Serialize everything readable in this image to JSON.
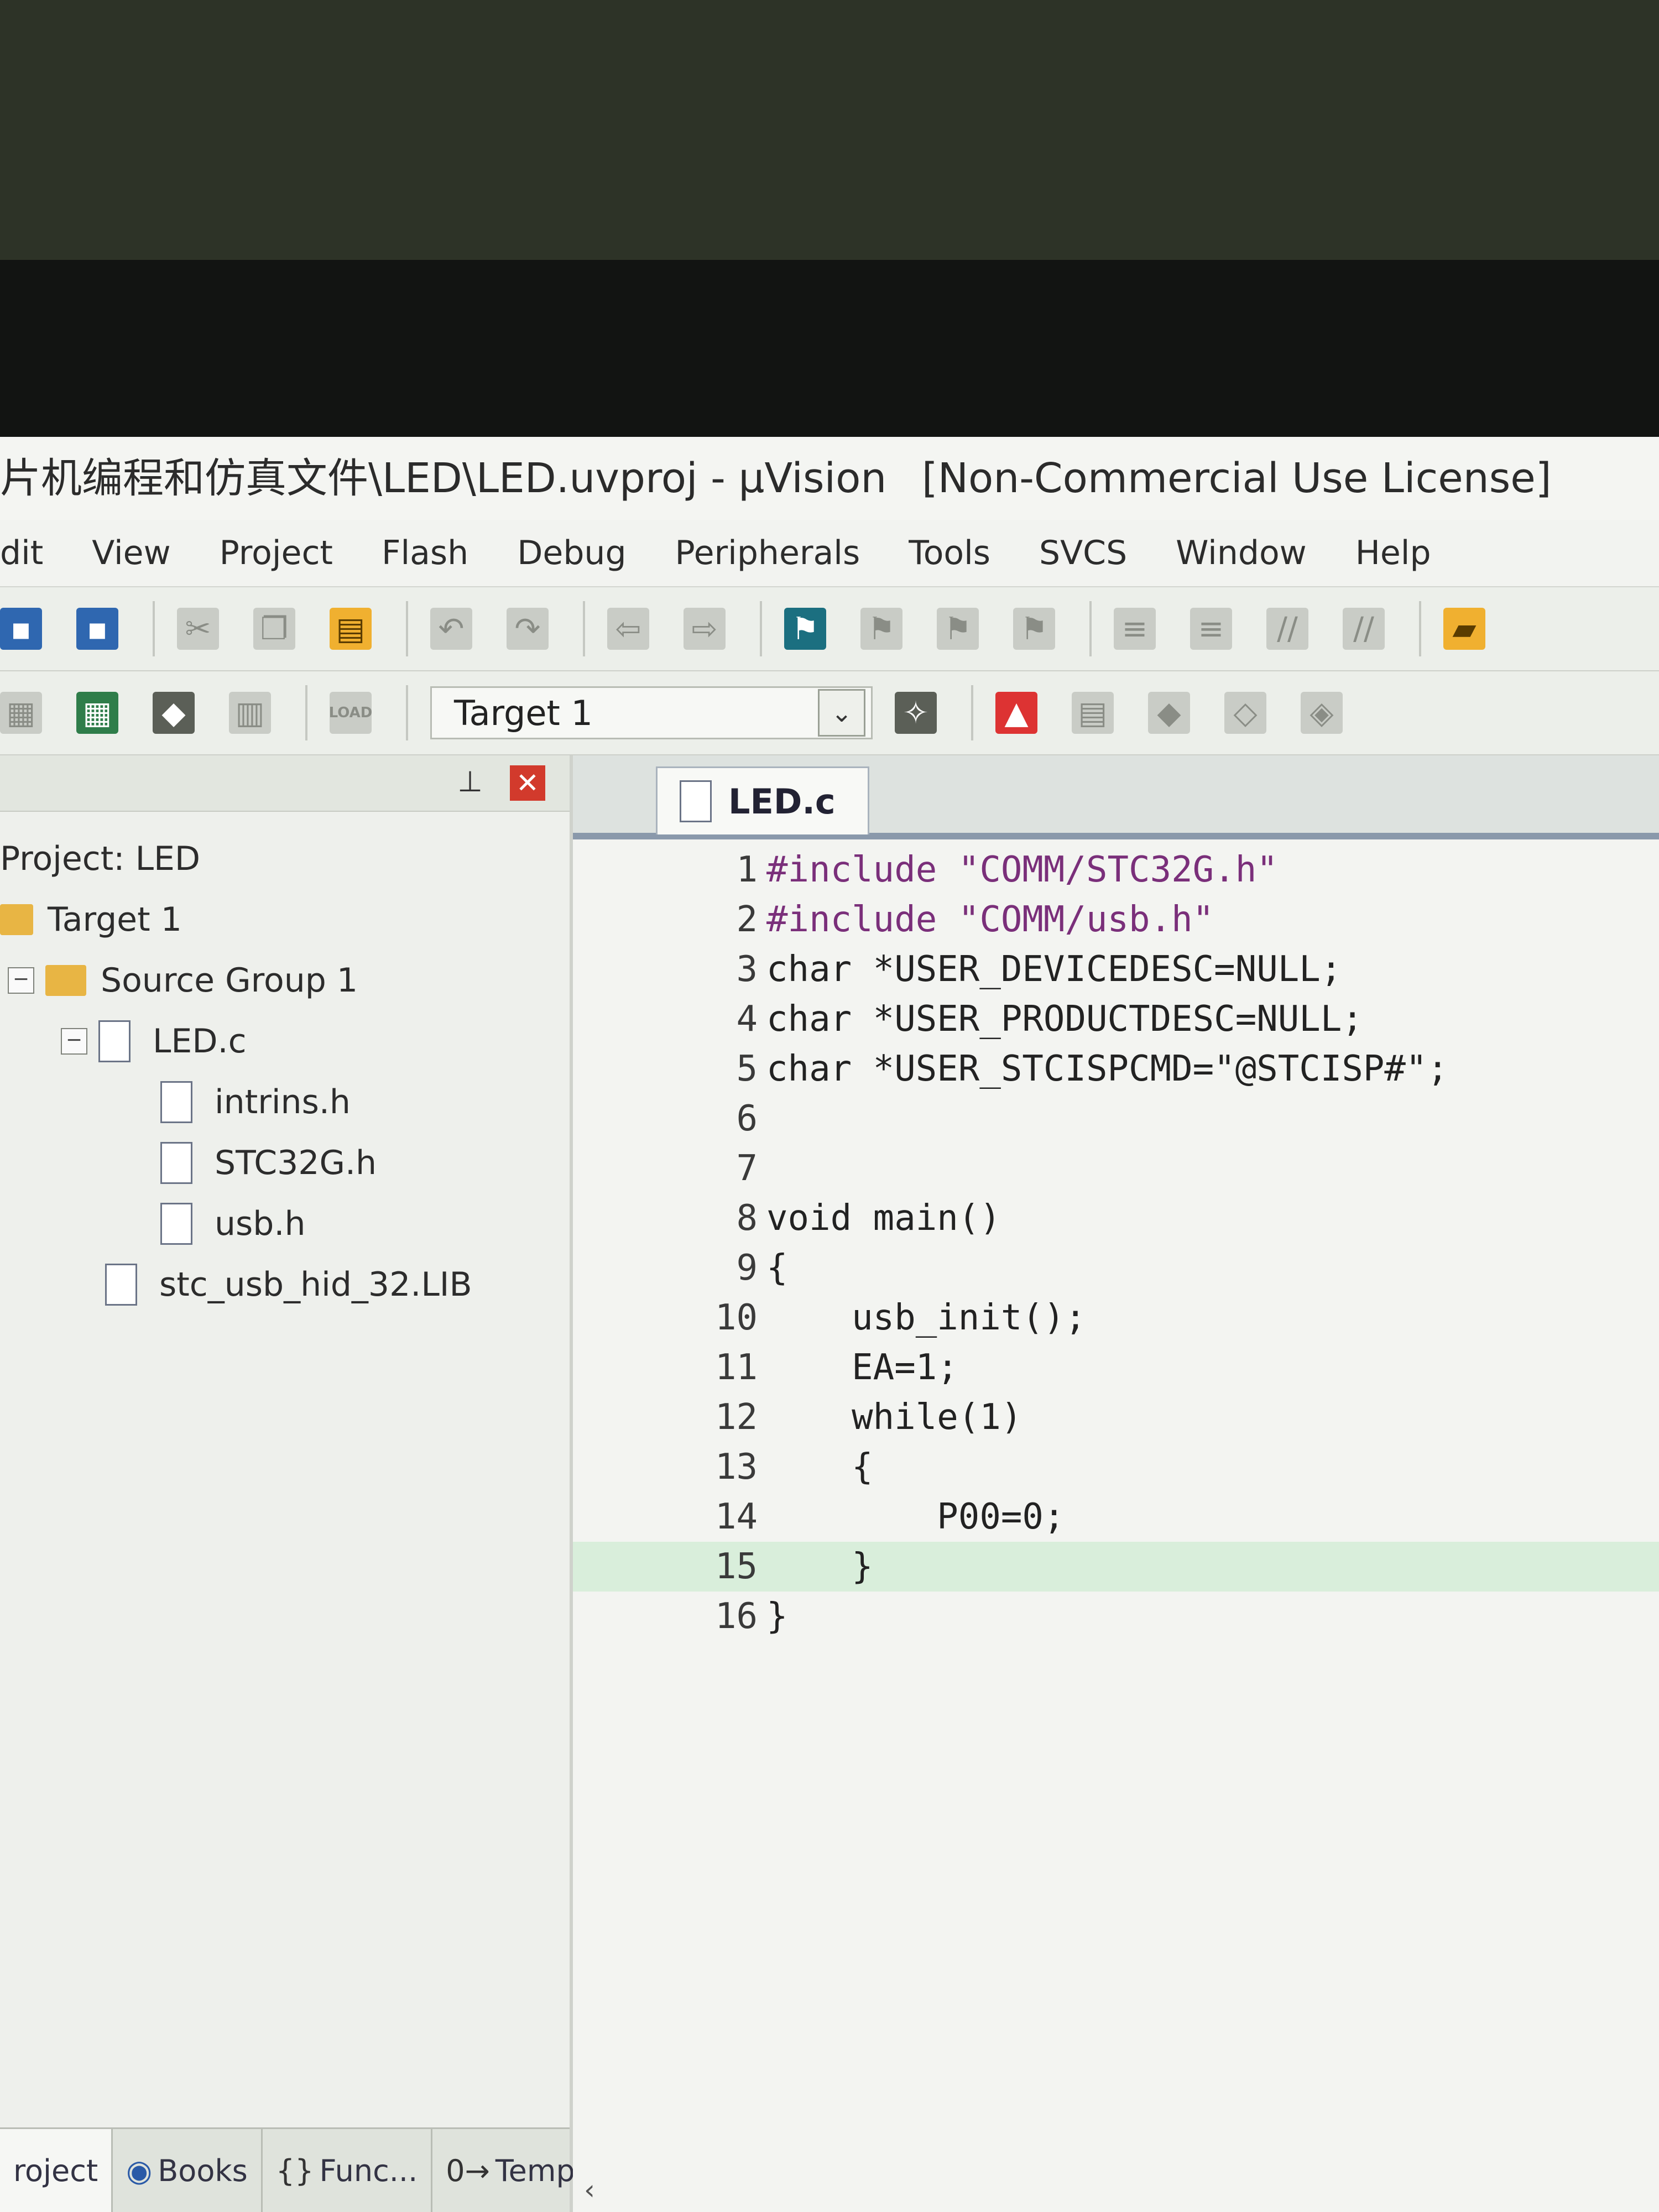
{
  "window": {
    "title_path": "片机编程和仿真文件\\LED\\LED.uvproj - µVision",
    "title_license": "[Non-Commercial Use License]"
  },
  "menu": [
    "dit",
    "View",
    "Project",
    "Flash",
    "Debug",
    "Peripherals",
    "Tools",
    "SVCS",
    "Window",
    "Help"
  ],
  "toolbar2": {
    "target_label": "Target 1",
    "load_label": "LOAD"
  },
  "project_panel": {
    "root": "Project: LED",
    "target": "Target 1",
    "group": "Source Group 1",
    "file_main": "LED.c",
    "includes": [
      "intrins.h",
      "STC32G.h",
      "usb.h"
    ],
    "lib": "stc_usb_hid_32.LIB",
    "tabs": [
      "roject",
      "Books",
      "Func...",
      "Temp..."
    ]
  },
  "editor": {
    "tab_label": "LED.c",
    "lines": [
      {
        "n": "1",
        "t": "#include \"COMM/STC32G.h\""
      },
      {
        "n": "2",
        "t": "#include \"COMM/usb.h\""
      },
      {
        "n": "3",
        "t": "char *USER_DEVICEDESC=NULL;"
      },
      {
        "n": "4",
        "t": "char *USER_PRODUCTDESC=NULL;"
      },
      {
        "n": "5",
        "t": "char *USER_STCISPCMD=\"@STCISP#\";"
      },
      {
        "n": "6",
        "t": ""
      },
      {
        "n": "7",
        "t": ""
      },
      {
        "n": "8",
        "t": "void main()"
      },
      {
        "n": "9",
        "t": "{"
      },
      {
        "n": "10",
        "t": "    usb_init();"
      },
      {
        "n": "11",
        "t": "    EA=1;"
      },
      {
        "n": "12",
        "t": "    while(1)"
      },
      {
        "n": "13",
        "t": "    {"
      },
      {
        "n": "14",
        "t": "        P00=0;"
      },
      {
        "n": "15",
        "t": "    }"
      },
      {
        "n": "16",
        "t": "}"
      }
    ]
  }
}
